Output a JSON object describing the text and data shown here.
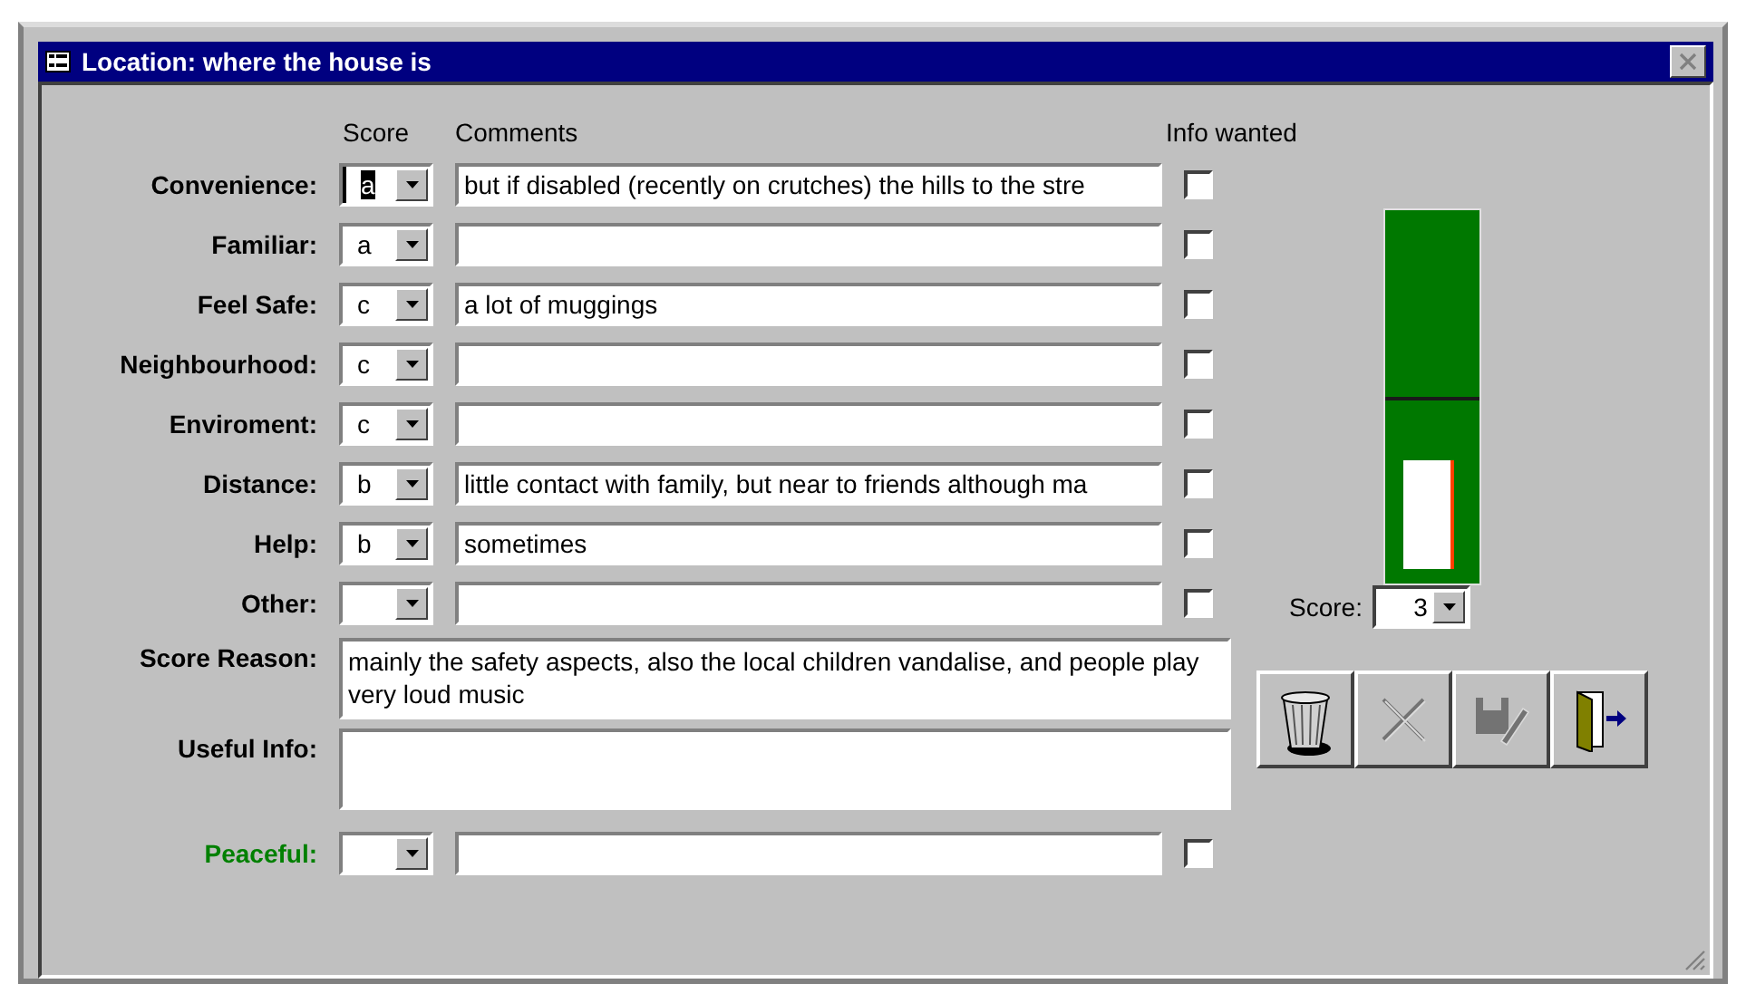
{
  "window": {
    "title": "Location: where the house is"
  },
  "headers": {
    "score": "Score",
    "comments": "Comments",
    "info": "Info wanted"
  },
  "rows": [
    {
      "label": "Convenience:",
      "score": "a",
      "focused": true,
      "comment": "but if disabled (recently on crutches) the hills to the stre",
      "info_wanted": false
    },
    {
      "label": "Familiar:",
      "score": "a",
      "focused": false,
      "info_wanted": false
    },
    {
      "label": "Feel Safe:",
      "score": "c",
      "focused": false,
      "comment": "a lot of muggings",
      "info_wanted": false
    },
    {
      "label": "Neighbourhood:",
      "score": "c",
      "focused": false,
      "info_wanted": false
    },
    {
      "label": "Enviroment:",
      "score": "c",
      "focused": false,
      "info_wanted": false
    },
    {
      "label": "Distance:",
      "score": "b",
      "focused": false,
      "comment": "little contact with family, but near to friends although ma",
      "info_wanted": false
    },
    {
      "label": "Help:",
      "score": "b",
      "focused": false,
      "comment": "sometimes",
      "info_wanted": false
    },
    {
      "label": "Other:",
      "focused": false,
      "info_wanted": false
    }
  ],
  "score_reason": {
    "label": "Score Reason:",
    "value": "mainly the safety aspects, also the local children vandalise, and people play very loud music"
  },
  "useful_info": {
    "label": "Useful Info:"
  },
  "peaceful": {
    "label": "Peaceful:",
    "info_wanted": false
  },
  "meter": {
    "score_label": "Score:",
    "score": "3"
  },
  "buttons": [
    {
      "kind": "delete",
      "disabled": false
    },
    {
      "kind": "undo",
      "disabled": true
    },
    {
      "kind": "save",
      "disabled": true
    },
    {
      "kind": "exit",
      "disabled": false
    }
  ]
}
